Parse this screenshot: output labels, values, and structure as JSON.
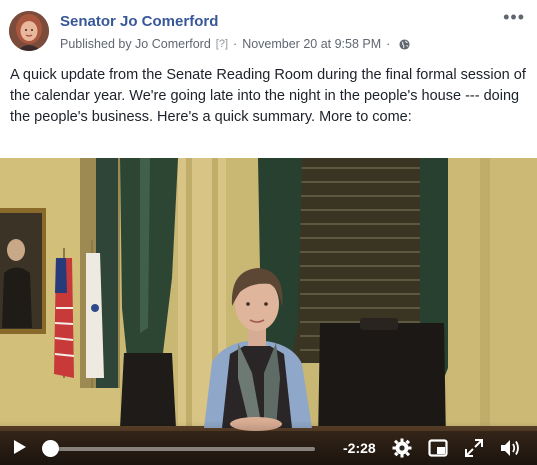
{
  "post": {
    "page_name": "Senator Jo Comerford",
    "published_by": "Published by Jo Comerford",
    "help_marker": "[?]",
    "separator": "·",
    "date": "November 20 at 9:58 PM",
    "audience_icon": "globe-icon",
    "more_icon": "more-options-icon",
    "more_label": "•••",
    "text": "A quick update from the Senate Reading Room during the final formal session of the calendar year. We're going late into the night in the people's house --- doing the people's business. Here's a quick summary. More to come:"
  },
  "video": {
    "time_remaining": "-2:28",
    "progress": 0.02,
    "controls": [
      "play-icon",
      "settings-icon",
      "picture-in-picture-icon",
      "fullscreen-icon",
      "volume-icon"
    ]
  }
}
